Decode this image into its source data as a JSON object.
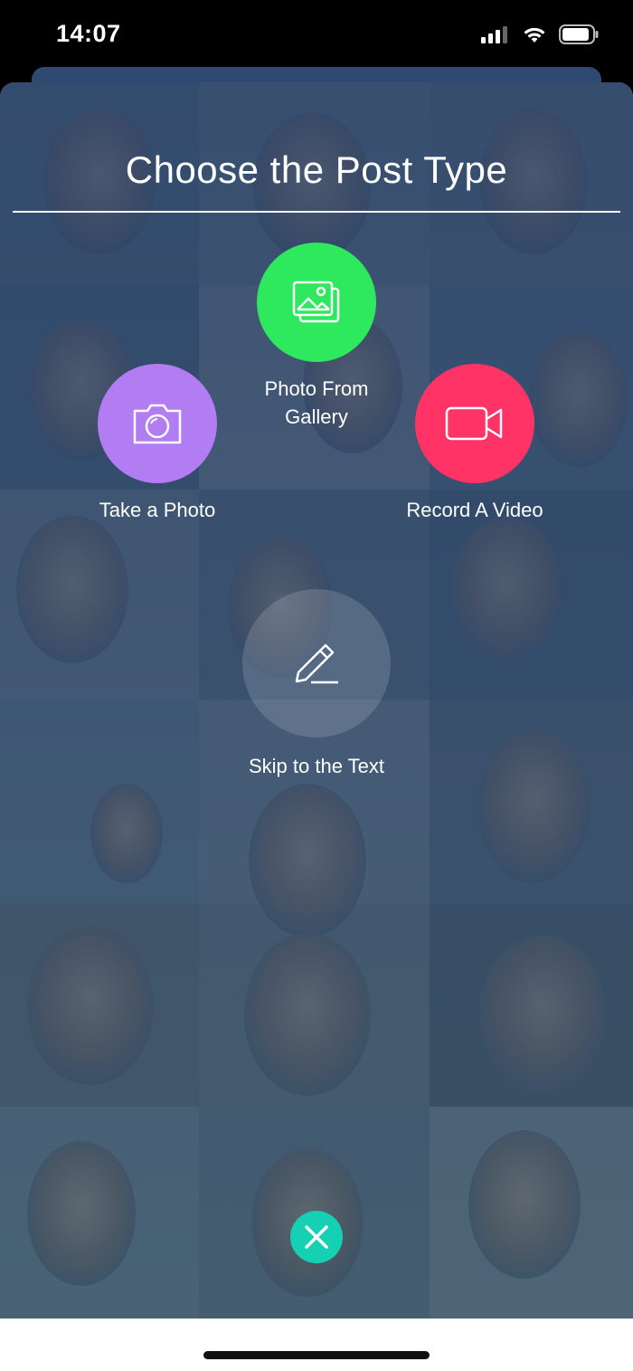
{
  "status_bar": {
    "time": "14:07",
    "icons": [
      "cellular-signal-icon",
      "wifi-icon",
      "battery-icon"
    ]
  },
  "sheet": {
    "title": "Choose the Post Type",
    "background": "photo-mosaic"
  },
  "options": {
    "gallery": {
      "label": "Photo From Gallery",
      "icon": "gallery-icon",
      "color": "#2ee85e"
    },
    "photo": {
      "label": "Take a Photo",
      "icon": "camera-icon",
      "color": "#b27cf2"
    },
    "video": {
      "label": "Record A Video",
      "icon": "video-camera-icon",
      "color": "#ff3366"
    },
    "text": {
      "label": "Skip to the Text",
      "icon": "pencil-icon",
      "color": "rgba(255,255,255,0.15)"
    }
  },
  "close": {
    "icon": "close-icon",
    "color": "#16d0b4"
  }
}
